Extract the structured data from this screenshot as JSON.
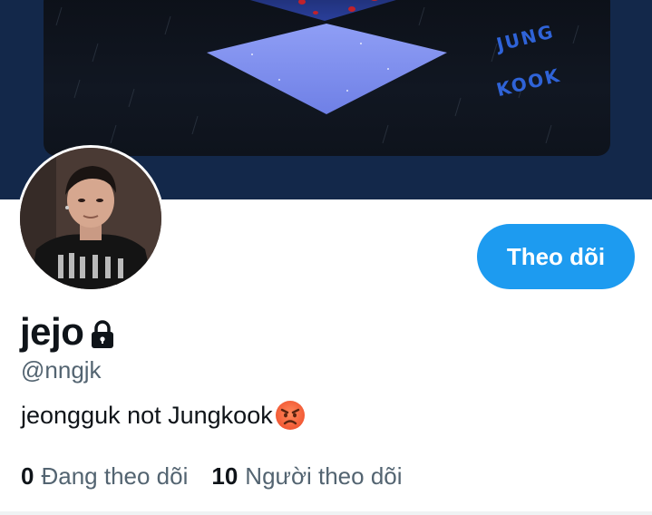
{
  "banner": {
    "text_line1": "JUNG",
    "text_line2": "KOOK"
  },
  "profile": {
    "display_name": "jejo",
    "handle": "@nngjk",
    "bio": "jeongguk not Jungkook",
    "bio_emoji_icon": "pouting-face-icon",
    "locked_icon": "lock-icon"
  },
  "follow_button": {
    "label": "Theo dõi"
  },
  "stats": {
    "following_count": "0",
    "following_label": "Đang theo dõi",
    "followers_count": "10",
    "followers_label": "Người theo dõi"
  },
  "colors": {
    "accent": "#1d9bf0",
    "banner_bg": "#13284a",
    "text_primary": "#0f1419",
    "text_secondary": "#536471"
  }
}
